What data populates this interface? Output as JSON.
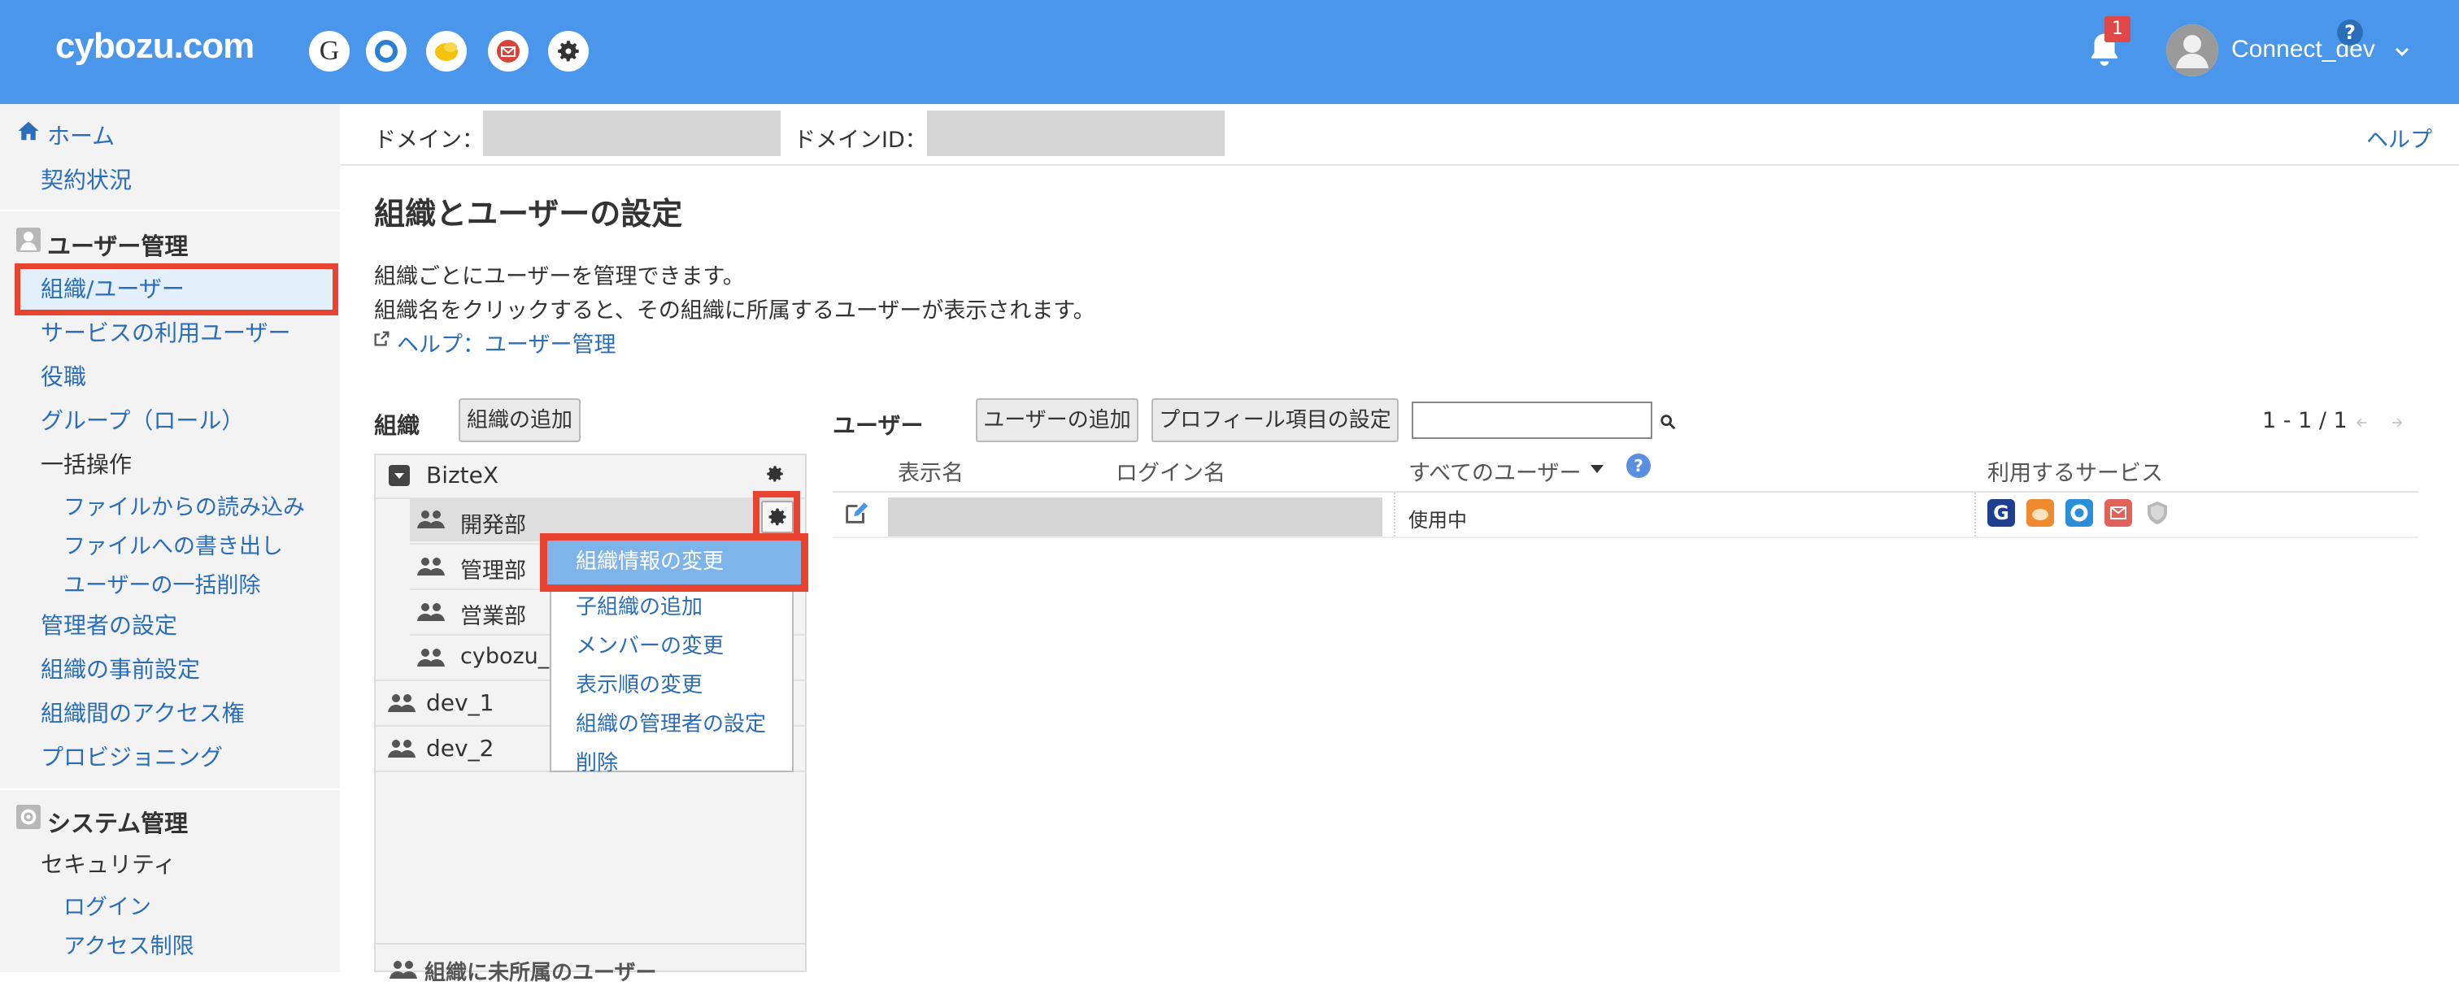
{
  "header": {
    "logo": "cybozu.com",
    "notification_count": "1",
    "username": "Connect_dev"
  },
  "sidebar": {
    "home": "ホーム",
    "contract": "契約状況",
    "user_mgmt_heading": "ユーザー管理",
    "items": [
      "組織/ユーザー",
      "サービスの利用ユーザー",
      "役職",
      "グループ（ロール）",
      "一括操作",
      "ファイルからの読み込み",
      "ファイルへの書き出し",
      "ユーザーの一括削除",
      "管理者の設定",
      "組織の事前設定",
      "組織間のアクセス権",
      "プロビジョニング"
    ],
    "system_heading": "システム管理",
    "system_items": [
      "セキュリティ",
      "ログイン",
      "アクセス制限"
    ]
  },
  "domainbar": {
    "domain_label": "ドメイン：",
    "domain_id_label": "ドメインID：",
    "help": "ヘルプ"
  },
  "main": {
    "title": "組織とユーザーの設定",
    "desc1": "組織ごとにユーザーを管理できます。",
    "desc2": "組織名をクリックすると、その組織に所属するユーザーが表示されます。",
    "help_link": "ヘルプ：ユーザー管理"
  },
  "org": {
    "label": "組織",
    "add_button": "組織の追加",
    "root": "BizteX",
    "children": [
      "開発部",
      "管理部",
      "営業部",
      "cybozu_c"
    ],
    "others": [
      "dev_1",
      "dev_2"
    ],
    "unassigned": "組織に未所属のユーザー"
  },
  "menu": {
    "items": [
      "組織情報の変更",
      "子組織の追加",
      "メンバーの変更",
      "表示順の変更",
      "組織の管理者の設定",
      "削除"
    ]
  },
  "users": {
    "label": "ユーザー",
    "add_button": "ユーザーの追加",
    "profile_button": "プロフィール項目の設定",
    "search_value": "",
    "pager": "1 - 1 / 1",
    "columns": [
      "表示名",
      "ログイン名",
      "すべてのユーザー",
      "利用するサービス"
    ],
    "rows": [
      {
        "status": "使用中",
        "services": [
          "garoon-icon",
          "kintone-icon",
          "office-icon",
          "mail-icon",
          "secure-access-icon"
        ]
      }
    ]
  },
  "colors": {
    "header_bg": "#4a96ea",
    "link": "#2a6db8",
    "highlight": "#e8432e"
  }
}
